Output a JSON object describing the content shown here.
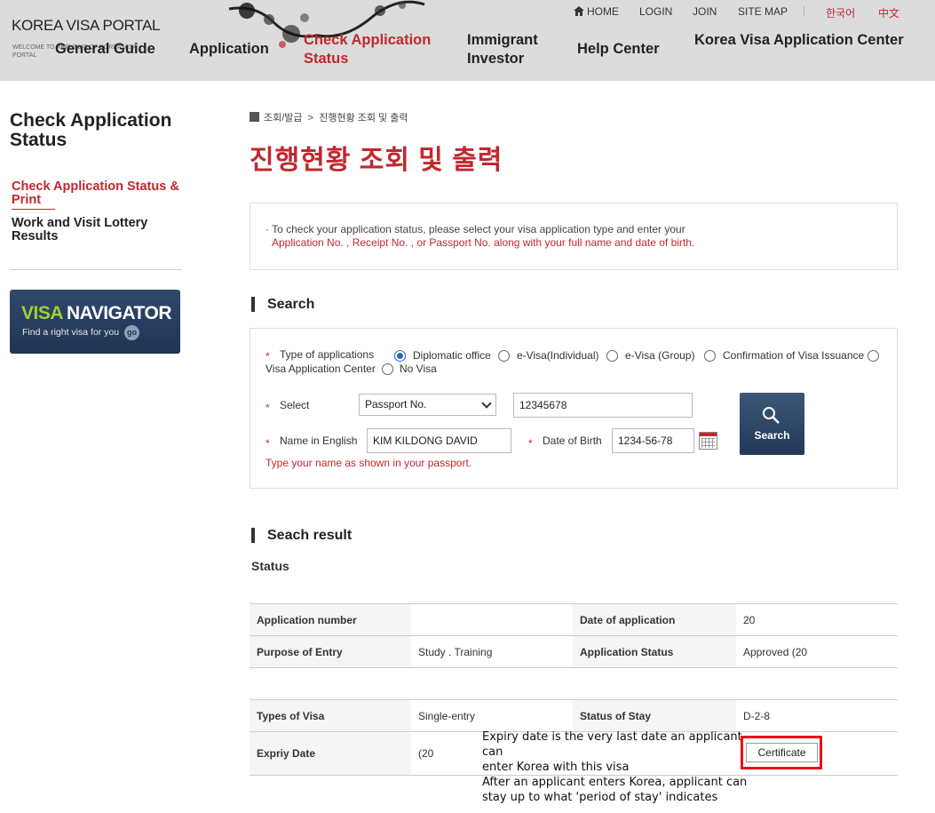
{
  "header": {
    "logo_title": "KOREA VISA PORTAL",
    "logo_subtitle": "WELCOME TO REPUBLIC OF KOREA VISA PORTAL",
    "utility": [
      "HOME",
      "LOGIN",
      "JOIN",
      "SITE MAP",
      "한국어",
      "中文"
    ],
    "gnb": [
      "General Guide",
      "Application",
      "Check Application Status",
      "Immigrant Investor",
      "Help Center",
      "Korea Visa Application Center"
    ]
  },
  "sidebar": {
    "title": "Check Application Status",
    "items": [
      {
        "label": "Check Application Status & Print",
        "active": true
      },
      {
        "label": "Work and Visit Lottery Results",
        "active": false
      }
    ],
    "banner": {
      "brand_a": "VISA",
      "brand_b": "NAVIGATOR",
      "tagline": "Find a right visa for you",
      "go": "go"
    }
  },
  "breadcrumb": [
    "조회/발급",
    "진행현황 조회 및 출력"
  ],
  "page_title": "진행현황 조회 및 출력",
  "info": {
    "line1": "· To check your application status, please select your visa application type and enter your",
    "line2": "Application No. , Receipt No. , or Passport No. along with your full name and date of birth."
  },
  "search_section": {
    "heading": "Search",
    "type_label": "Type of applications",
    "types": [
      {
        "label": "Diplomatic office",
        "checked": true
      },
      {
        "label": "e-Visa(Individual)",
        "checked": false
      },
      {
        "label": "e-Visa (Group)",
        "checked": false
      },
      {
        "label": "Confirmation of Visa Issuance",
        "checked": false
      },
      {
        "label": "Visa Application Center",
        "checked": false
      },
      {
        "label": "No Visa",
        "checked": false
      }
    ],
    "select_label": "Select",
    "select_value": "Passport No.",
    "number_value": "12345678",
    "name_label": "Name in English",
    "name_value": "KIM KILDONG DAVID",
    "dob_label": "Date of Birth",
    "dob_value": "1234-56-78",
    "search_button": "Search",
    "hint": "Type your name as shown in your passport."
  },
  "result_section": {
    "heading": "Seach result",
    "subheading": "Status",
    "table1": [
      [
        "Application number",
        "",
        "Date of application",
        "20"
      ],
      [
        "Purpose of Entry",
        "Study . Training",
        "Application Status",
        "Approved (20"
      ]
    ],
    "table2": [
      [
        "Types of Visa",
        "Single-entry",
        "Status of Stay",
        "D-2-8"
      ],
      [
        "Expriy Date",
        "(20",
        "",
        ""
      ]
    ],
    "certificate_button": "Certificate"
  },
  "annotation": [
    "Expiry date is the very last date an applicant can",
    "enter Korea with this visa",
    "After an applicant enters Korea, applicant can",
    "stay up to what 'period of stay' indicates"
  ]
}
